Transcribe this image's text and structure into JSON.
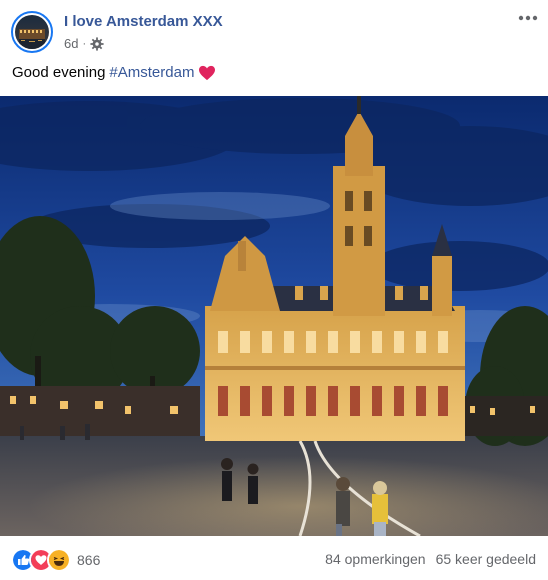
{
  "post": {
    "page_name": "I love Amsterdam XXX",
    "time": "6d",
    "meta_separator": "·",
    "privacy_icon": "gear-icon",
    "more_icon": "more-options-icon",
    "caption_text": "Good evening",
    "caption_hashtag": "#Amsterdam",
    "caption_emoji": "red-heart-emoji",
    "photo_subject": "illuminated-gothic-town-hall-at-dusk"
  },
  "footer": {
    "reaction_icons": [
      "like-icon",
      "love-icon",
      "haha-icon"
    ],
    "reaction_count": "866",
    "comments": "84 opmerkingen",
    "shares": "65 keer gedeeld"
  },
  "colors": {
    "link_blue": "#385898",
    "secondary_text": "#65676b",
    "avatar_ring": "#1877f2",
    "like_blue": "#1877f2",
    "love_red": "#f33e58",
    "haha_yellow": "#f7b125"
  }
}
